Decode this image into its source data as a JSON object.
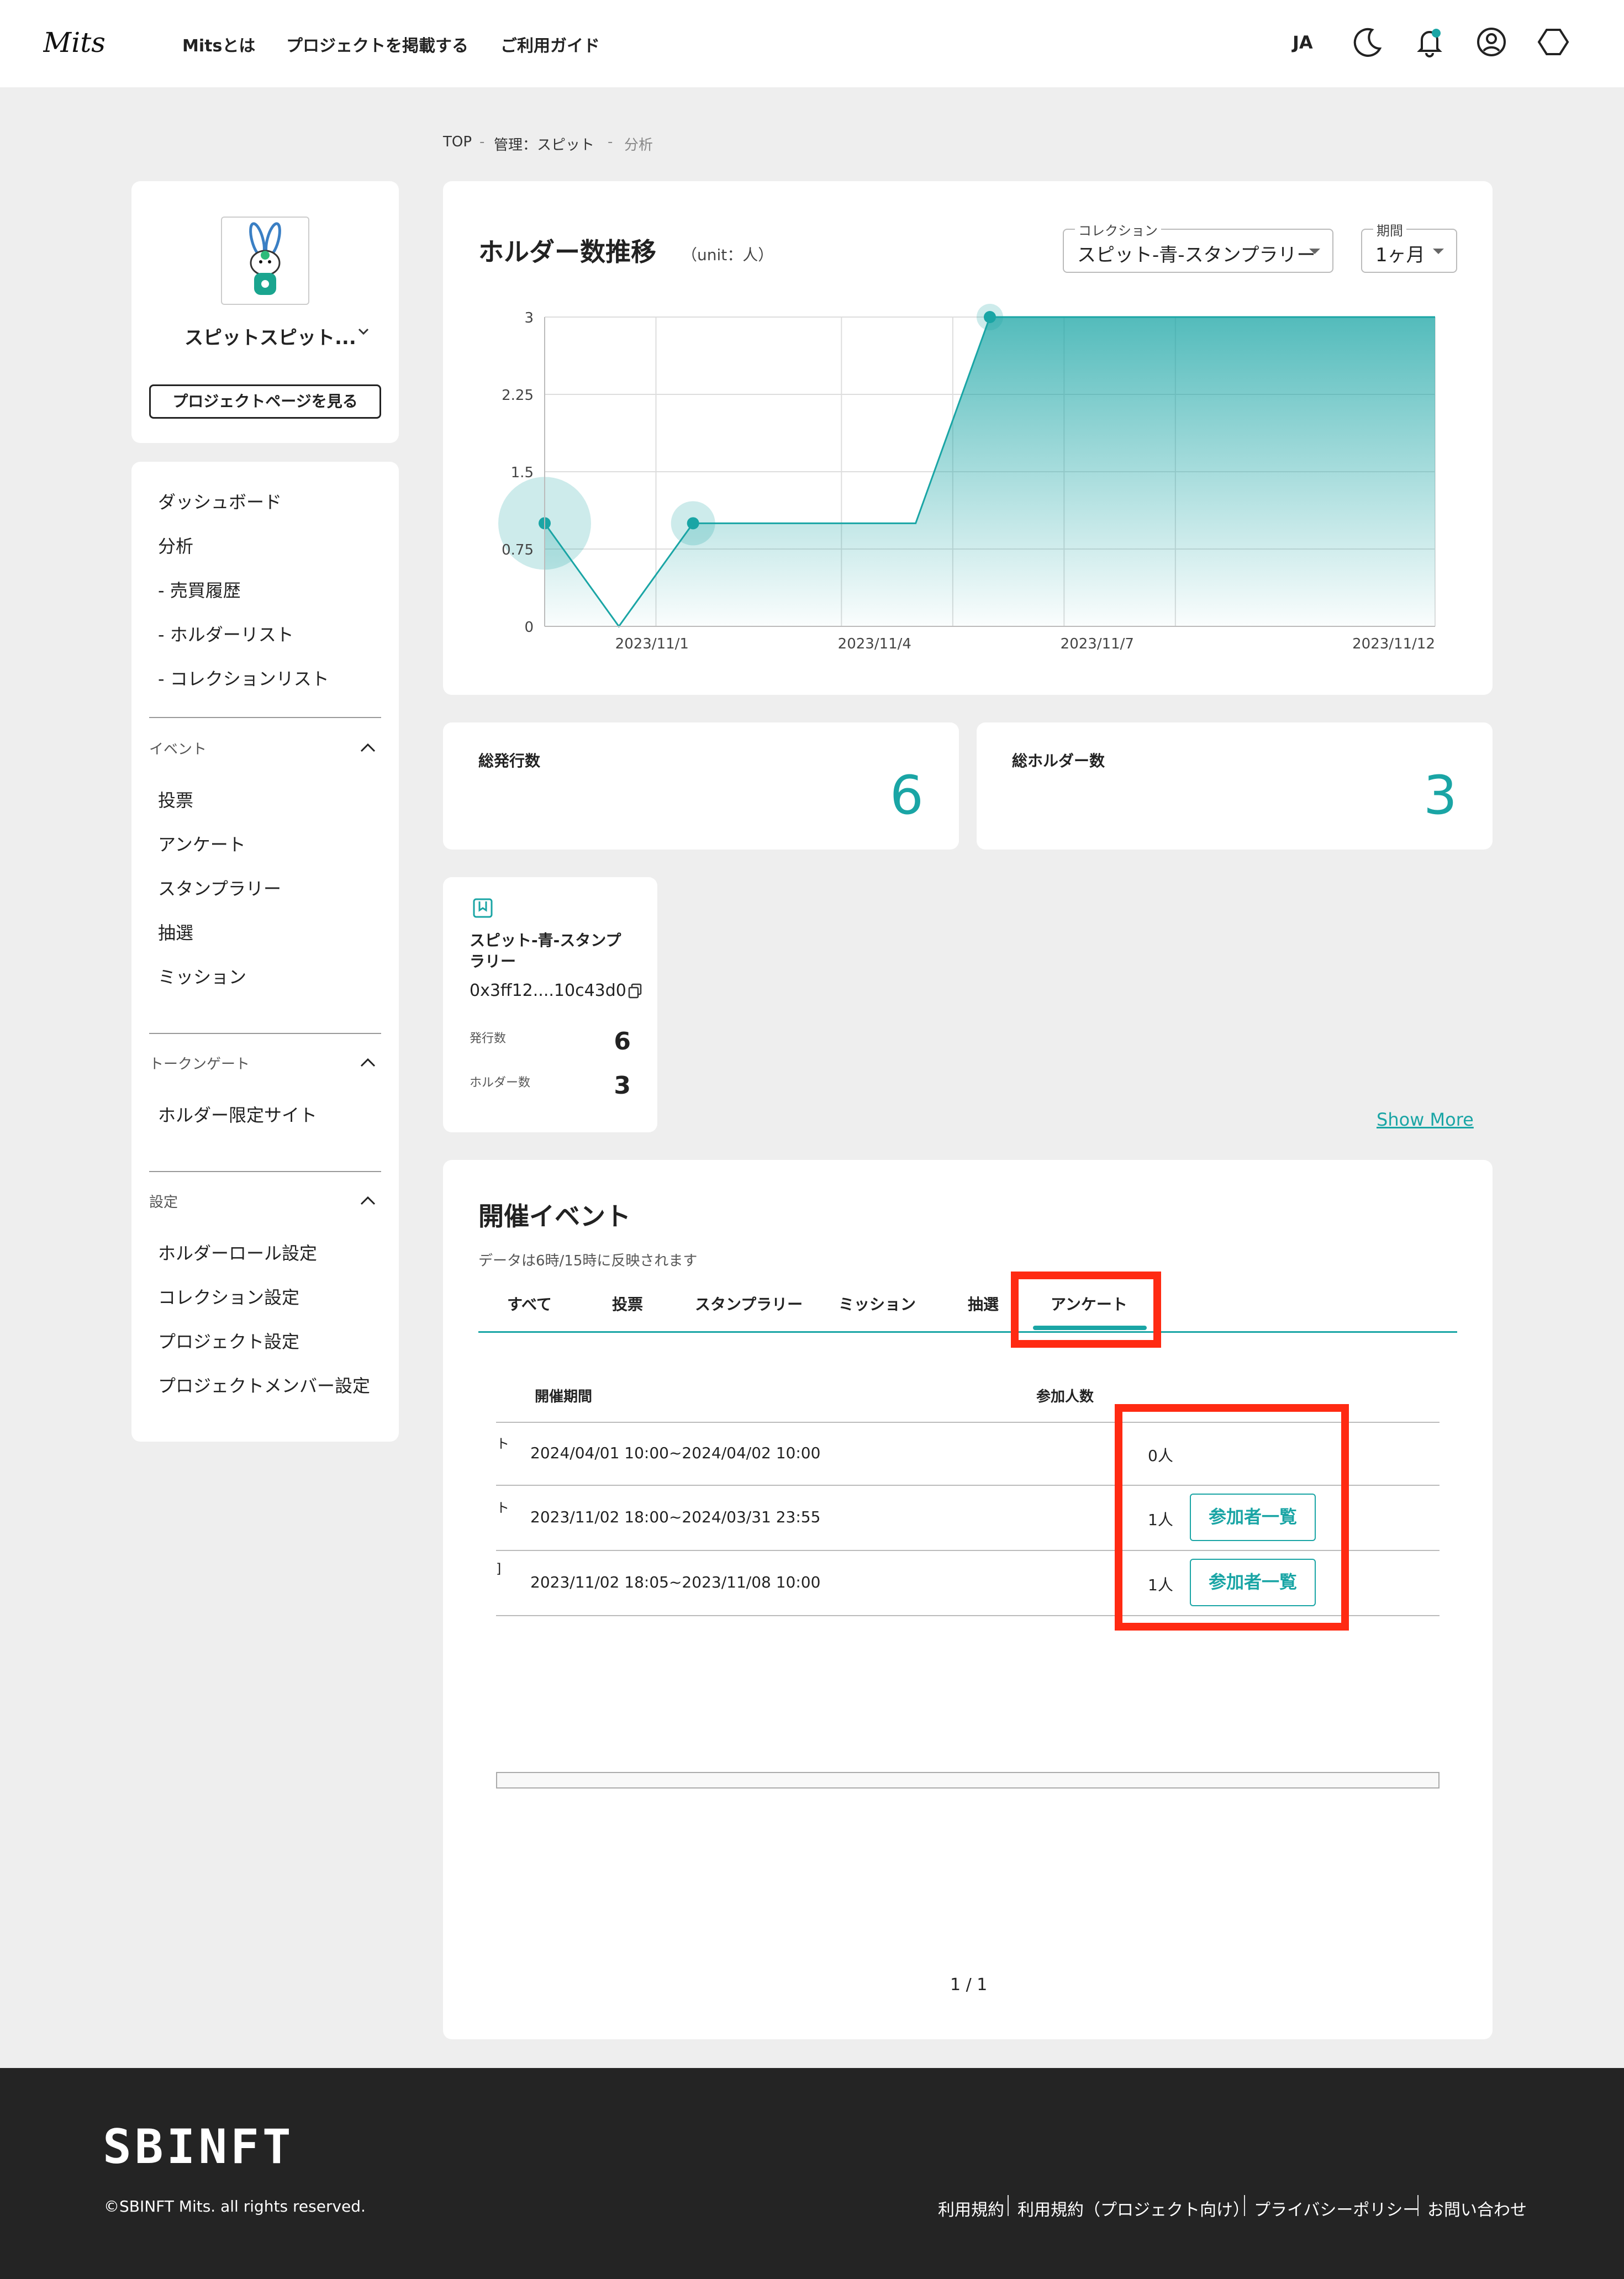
{
  "header": {
    "logo_text": "Mits",
    "nav": [
      "Mitsとは",
      "プロジェクトを掲載する",
      "ご利用ガイド"
    ],
    "language": "JA"
  },
  "breadcrumb": {
    "top": "TOP",
    "project": "管理：スピット",
    "current": "分析",
    "separator": "-"
  },
  "project_card": {
    "name": "スピットスピット...",
    "view_button": "プロジェクトページを見る"
  },
  "sidebar": {
    "main_items": [
      "ダッシュボード",
      "分析",
      "- 売買履歴",
      "- ホルダーリスト",
      "- コレクションリスト"
    ],
    "sections": [
      {
        "title": "イベント",
        "items": [
          "投票",
          "アンケート",
          "スタンプラリー",
          "抽選",
          "ミッション"
        ]
      },
      {
        "title": "トークンゲート",
        "items": [
          "ホルダー限定サイト"
        ]
      },
      {
        "title": "設定",
        "items": [
          "ホルダーロール設定",
          "コレクション設定",
          "プロジェクト設定",
          "プロジェクトメンバー設定"
        ]
      }
    ]
  },
  "holder_chart": {
    "title": "ホルダー数推移",
    "unit_label": "（unit：人）",
    "collection_label": "コレクション",
    "collection_value": "スピット-青-スタンプラリー",
    "period_label": "期間",
    "period_value": "1ヶ月"
  },
  "chart_data": {
    "type": "area",
    "title": "ホルダー数推移",
    "ylabel": "",
    "xlabel": "",
    "ylim": [
      0,
      3
    ],
    "y_ticks": [
      "0",
      "0.75",
      "1.5",
      "2.25",
      "3"
    ],
    "x_tick_labels": [
      "2023/11/1",
      "2023/11/4",
      "2023/11/7",
      "2023/11/12"
    ],
    "x_tick_days": [
      1,
      4,
      7,
      12
    ],
    "xlim_days": [
      0,
      12
    ],
    "points": [
      {
        "x": "2023/10/31",
        "day": 0,
        "y": 1
      },
      {
        "x": "2023/11/1",
        "day": 1,
        "y": 0
      },
      {
        "x": "2023/11/2",
        "day": 2,
        "y": 1
      },
      {
        "x": "2023/11/5",
        "day": 5,
        "y": 1
      },
      {
        "x": "2023/11/6",
        "day": 6,
        "y": 3
      },
      {
        "x": "2023/11/12",
        "day": 12,
        "y": 3
      }
    ],
    "markers_days": [
      0,
      2,
      6
    ],
    "grid": true,
    "color": "#1aa5a5"
  },
  "stats": {
    "total_issued_label": "総発行数",
    "total_issued_value": "6",
    "total_holders_label": "総ホルダー数",
    "total_holders_value": "3"
  },
  "collection_card": {
    "name": "スピット-青-スタンプラリー",
    "address": "0x3ff12....10c43d0",
    "issued_label": "発行数",
    "issued_value": "6",
    "holders_label": "ホルダー数",
    "holders_value": "3"
  },
  "show_more": "Show More",
  "events": {
    "title": "開催イベント",
    "note": "データは6時/15時に反映されます",
    "tabs": [
      "すべて",
      "投票",
      "スタンプラリー",
      "ミッション",
      "抽選",
      "アンケート"
    ],
    "active_tab": "アンケート",
    "columns": {
      "period": "開催期間",
      "participants": "参加人数"
    },
    "rows": [
      {
        "edge": "ト",
        "period": "2024/04/01 10:00~2024/04/02 10:00",
        "participants": "0人",
        "button": ""
      },
      {
        "edge": "ト",
        "period": "2023/11/02 18:00~2024/03/31 23:55",
        "participants": "1人",
        "button": "参加者一覧"
      },
      {
        "edge": "]",
        "period": "2023/11/02 18:05~2023/11/08 10:00",
        "participants": "1人",
        "button": "参加者一覧"
      }
    ],
    "pagination": "1 / 1"
  },
  "footer": {
    "brand": "SBINFT",
    "copyright": "©SBINFT Mits. all rights reserved.",
    "links": [
      "利用規約",
      "利用規約（プロジェクト向け）",
      "プライバシーポリシー",
      "お問い合わせ"
    ]
  },
  "colors": {
    "accent": "#1aa5a5",
    "highlight": "#ff2a12",
    "footer_bg": "#242424"
  }
}
